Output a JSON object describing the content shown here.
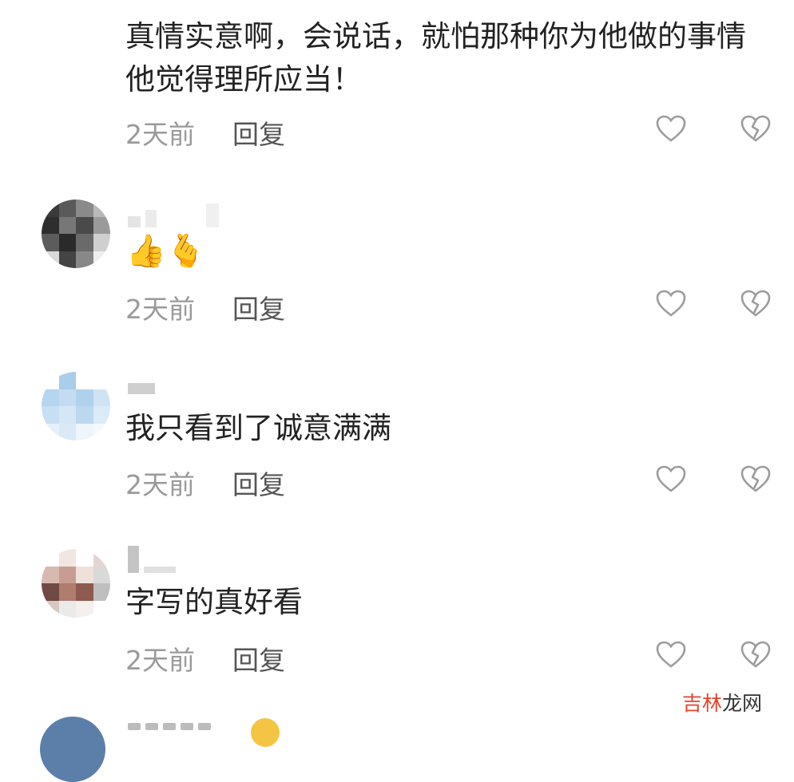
{
  "comments": [
    {
      "text": "真情实意啊，会说话，就怕那种你为他做的事情他觉得理所应当！",
      "time": "2天前",
      "reply": "回复"
    },
    {
      "emoji": "👍🫰",
      "time": "2天前",
      "reply": "回复"
    },
    {
      "text": "我只看到了诚意满满",
      "time": "2天前",
      "reply": "回复"
    },
    {
      "text": "字写的真好看",
      "time": "2天前",
      "reply": "回复"
    }
  ],
  "icons": {
    "like": "heart-outline-icon",
    "dislike": "broken-heart-icon"
  },
  "colors": {
    "text": "#222222",
    "meta": "#9a9a9a",
    "icon": "#9c9c9c"
  },
  "watermark": {
    "part1": "吉林",
    "part2": "龙网"
  }
}
